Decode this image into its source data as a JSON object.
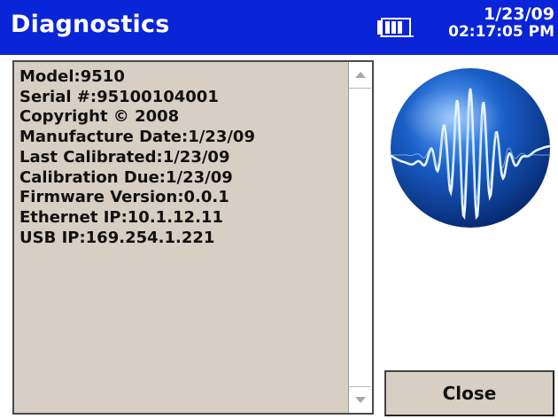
{
  "window": {
    "title": "Diagnostics",
    "date": "1/23/09",
    "time": "02:17:05 PM"
  },
  "info": {
    "lines": [
      "Model:9510",
      "Serial #:95100104001",
      "Copyright © 2008",
      "Manufacture Date:1/23/09",
      "Last Calibrated:1/23/09",
      "Calibration Due:1/23/09",
      "Firmware Version:0.0.1",
      "Ethernet IP:10.1.12.11",
      "USB IP:169.254.1.221"
    ]
  },
  "buttons": {
    "close_label": "Close"
  },
  "icons": {
    "battery": "battery-icon",
    "scroll_up": "scroll-up-arrow-icon",
    "scroll_down": "scroll-down-arrow-icon",
    "logo": "waveform-globe-logo"
  },
  "colors": {
    "titlebar": "#0a24d8",
    "panel_bg": "#d8cfc4"
  }
}
